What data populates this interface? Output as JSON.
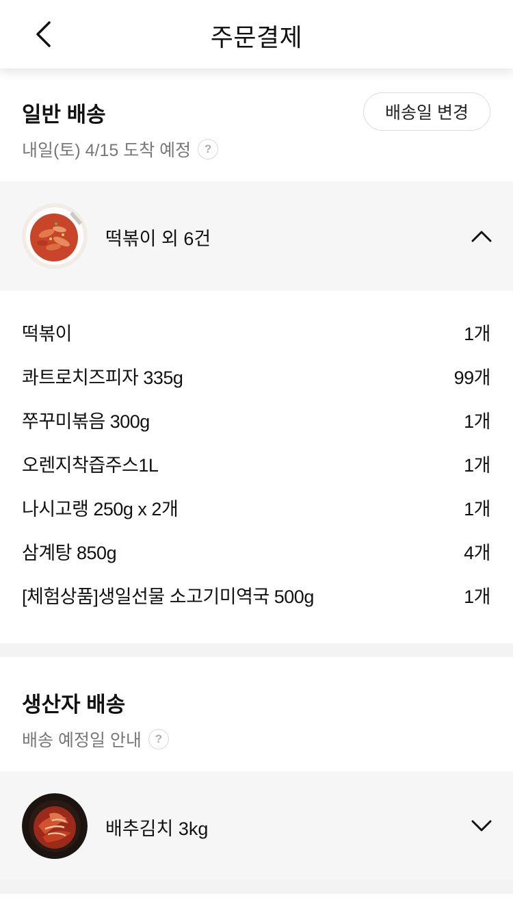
{
  "header": {
    "title": "주문결제",
    "back_icon": "chevron-left-icon"
  },
  "general_delivery": {
    "title": "일반 배송",
    "subtitle": "내일(토) 4/15 도착 예정",
    "help_symbol": "?",
    "change_button_label": "배송일 변경",
    "summary_label": "떡볶이 외 6건",
    "expanded": true,
    "items": [
      {
        "name": "떡볶이",
        "qty": "1개"
      },
      {
        "name": "콰트로치즈피자 335g",
        "qty": "99개"
      },
      {
        "name": "쭈꾸미볶음 300g",
        "qty": "1개"
      },
      {
        "name": "오렌지착즙주스1L",
        "qty": "1개"
      },
      {
        "name": "나시고랭 250g x 2개",
        "qty": "1개"
      },
      {
        "name": "삼계탕 850g",
        "qty": "4개"
      },
      {
        "name": "[체험상품]생일선물 소고기미역국 500g",
        "qty": "1개"
      }
    ]
  },
  "producer_delivery": {
    "title": "생산자 배송",
    "subtitle": "배송 예정일 안내",
    "help_symbol": "?",
    "summary_label": "배추김치 3kg",
    "expanded": false
  },
  "colors": {
    "text_primary": "#111111",
    "text_secondary": "#777777",
    "panel_background": "#f6f6f6",
    "divider": "#f3f3f3"
  }
}
